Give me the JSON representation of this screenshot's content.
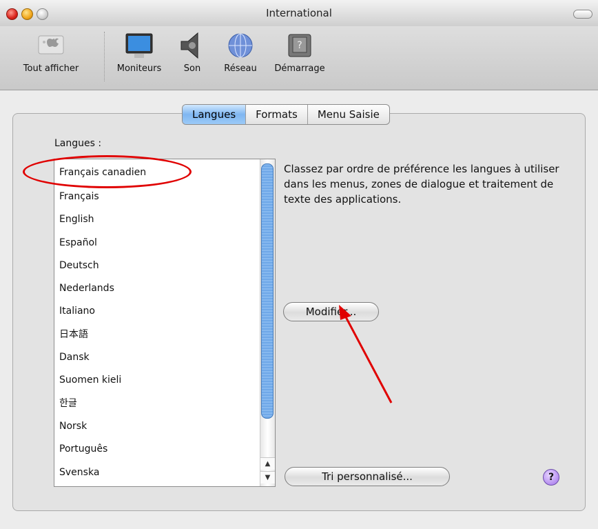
{
  "window": {
    "title": "International"
  },
  "toolbar": {
    "items": [
      {
        "label": "Tout afficher",
        "icon": "show-all-icon"
      },
      {
        "label": "Moniteurs",
        "icon": "monitor-icon"
      },
      {
        "label": "Son",
        "icon": "speaker-icon"
      },
      {
        "label": "Réseau",
        "icon": "network-globe-icon"
      },
      {
        "label": "Démarrage",
        "icon": "startup-disk-icon"
      }
    ]
  },
  "tabs": [
    {
      "label": "Langues",
      "active": true
    },
    {
      "label": "Formats",
      "active": false
    },
    {
      "label": "Menu Saisie",
      "active": false
    }
  ],
  "languages": {
    "label": "Langues :",
    "items": [
      "Français canadien",
      "Français",
      "English",
      "Español",
      "Deutsch",
      "Nederlands",
      "Italiano",
      "日本語",
      "Dansk",
      "Suomen kieli",
      "한글",
      "Norsk",
      "Português",
      "Svenska"
    ],
    "description": "Classez par ordre de préférence les langues à utiliser dans les menus, zones de dialogue et traitement de texte des applications."
  },
  "buttons": {
    "modify": "Modifier...",
    "custom_sort": "Tri personnalisé...",
    "help": "?"
  },
  "colors": {
    "annotation": "#e00000",
    "tab_active": "#7fb6f1"
  }
}
